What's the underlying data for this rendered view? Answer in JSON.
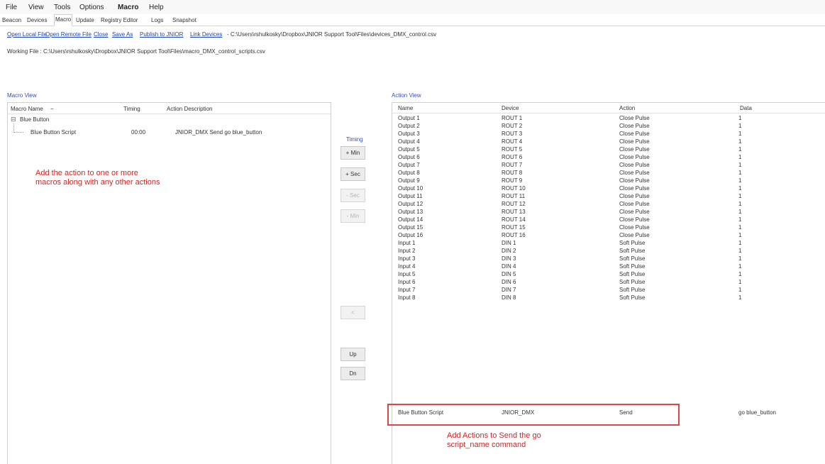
{
  "menu": [
    "File",
    "View",
    "Tools",
    "Options",
    "Macro",
    "Help"
  ],
  "tabs": [
    "Beacon",
    "Devices",
    "Macro",
    "Update",
    "Registry Editor",
    "Logs",
    "Snapshot"
  ],
  "links": [
    "Open Local File",
    "Open Remote File",
    "Close",
    "Save As",
    "Publish to JNIOR",
    "Link Devices"
  ],
  "devices_path": "- C:\\Users\\rshulkosky\\Dropbox\\JNIOR Support Tool\\Files\\devices_DMX_control.csv",
  "working_file": "Working File : C:\\Users\\rshulkosky\\Dropbox\\JNIOR Support Tool\\Files\\macro_DMX_control_scripts.csv",
  "macro_view": {
    "title": "Macro View",
    "headers": {
      "name": "Macro Name",
      "sort": "−",
      "timing": "Timing",
      "desc": "Action Description"
    },
    "group": "Blue Button",
    "group_toggle": "⊟",
    "item": {
      "name": "Blue Button Script",
      "timing": "00:00",
      "desc": "JNIOR_DMX Send go blue_button"
    }
  },
  "annotation_left": [
    "Add the action to one or more",
    "macros along with any other actions"
  ],
  "timing": {
    "title": "Timing",
    "buttons": [
      "+ Min",
      "+ Sec",
      "- Sec",
      "- Min"
    ],
    "arrow": "<",
    "up": "Up",
    "dn": "Dn"
  },
  "action_view": {
    "title": "Action View",
    "headers": {
      "name": "Name",
      "device": "Device",
      "action": "Action",
      "data": "Data"
    },
    "rows": [
      [
        "Output 1",
        "ROUT 1",
        "Close Pulse",
        "1"
      ],
      [
        "Output 2",
        "ROUT 2",
        "Close Pulse",
        "1"
      ],
      [
        "Output 3",
        "ROUT 3",
        "Close Pulse",
        "1"
      ],
      [
        "Output 4",
        "ROUT 4",
        "Close Pulse",
        "1"
      ],
      [
        "Output 5",
        "ROUT 5",
        "Close Pulse",
        "1"
      ],
      [
        "Output 6",
        "ROUT 6",
        "Close Pulse",
        "1"
      ],
      [
        "Output 7",
        "ROUT 7",
        "Close Pulse",
        "1"
      ],
      [
        "Output 8",
        "ROUT 8",
        "Close Pulse",
        "1"
      ],
      [
        "Output 9",
        "ROUT 9",
        "Close Pulse",
        "1"
      ],
      [
        "Output 10",
        "ROUT 10",
        "Close Pulse",
        "1"
      ],
      [
        "Output 11",
        "ROUT 11",
        "Close Pulse",
        "1"
      ],
      [
        "Output 12",
        "ROUT 12",
        "Close Pulse",
        "1"
      ],
      [
        "Output 13",
        "ROUT 13",
        "Close Pulse",
        "1"
      ],
      [
        "Output 14",
        "ROUT 14",
        "Close Pulse",
        "1"
      ],
      [
        "Output 15",
        "ROUT 15",
        "Close Pulse",
        "1"
      ],
      [
        "Output 16",
        "ROUT 16",
        "Close Pulse",
        "1"
      ],
      [
        "Input 1",
        "DIN 1",
        "Soft Pulse",
        "1"
      ],
      [
        "Input 2",
        "DIN 2",
        "Soft Pulse",
        "1"
      ],
      [
        "Input 3",
        "DIN 3",
        "Soft Pulse",
        "1"
      ],
      [
        "Input 4",
        "DIN 4",
        "Soft Pulse",
        "1"
      ],
      [
        "Input 5",
        "DIN 5",
        "Soft Pulse",
        "1"
      ],
      [
        "Input 6",
        "DIN 6",
        "Soft Pulse",
        "1"
      ],
      [
        "Input 7",
        "DIN 7",
        "Soft Pulse",
        "1"
      ],
      [
        "Input 8",
        "DIN 8",
        "Soft Pulse",
        "1"
      ]
    ],
    "highlight_row": [
      "Blue Button Script",
      "JNIOR_DMX",
      "Send",
      "go blue_button"
    ]
  },
  "annotation_right": [
    "Add Actions to Send the go",
    "script_name command"
  ],
  "colors": {
    "link": "#1c46b8",
    "annotation": "#d02727",
    "highlight_border": "#e04545"
  }
}
